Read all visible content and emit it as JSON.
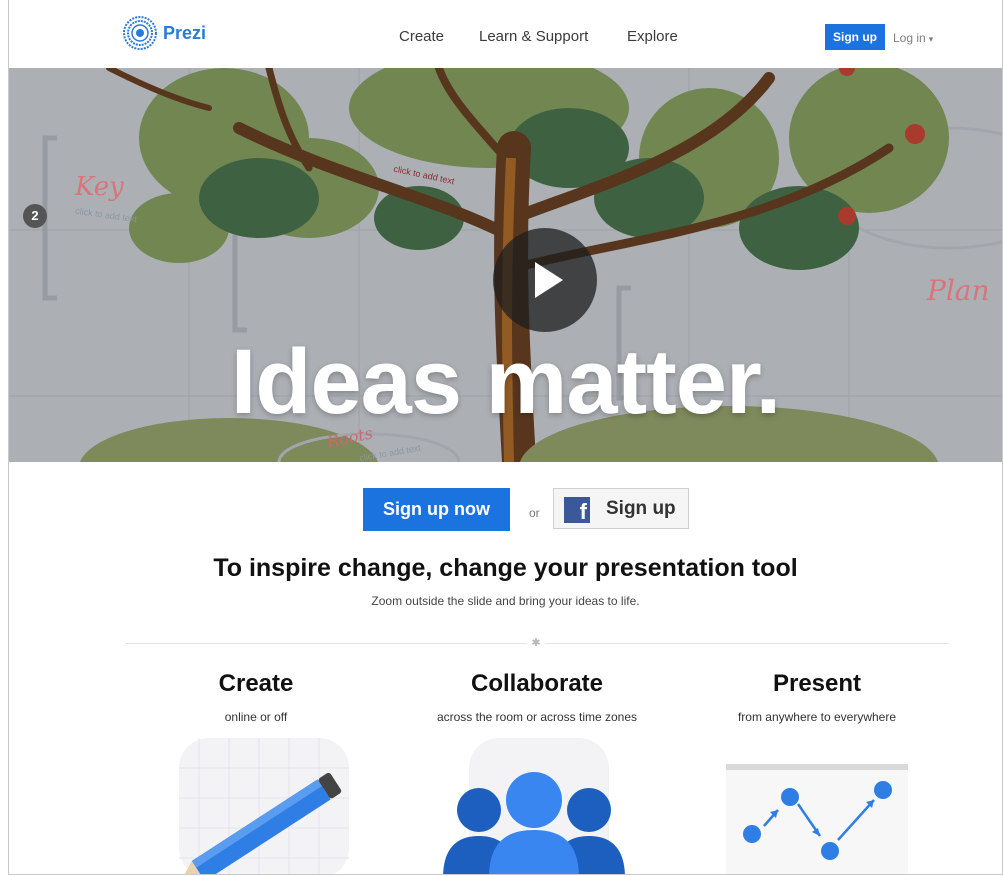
{
  "header": {
    "logo_text": "Prezi",
    "nav": [
      "Create",
      "Learn & Support",
      "Explore"
    ],
    "signup_label": "Sign up",
    "login_label": "Log in",
    "login_caret": "▾"
  },
  "hero": {
    "title": "Ideas matter.",
    "step_number": "2",
    "labels": {
      "key": "Key",
      "plan": "Plan",
      "roots": "Roots"
    },
    "hint_text": "click to add text"
  },
  "cta": {
    "primary_label": "Sign up now",
    "or_text": "or",
    "facebook_icon": "f",
    "facebook_label": "Sign up"
  },
  "tagline": {
    "title": "To inspire change, change your presentation tool",
    "subtitle": "Zoom outside the slide and bring your ideas to life."
  },
  "divider_icon": "✱",
  "features": [
    {
      "title": "Create",
      "subtitle": "online or off",
      "icon": "pencil-icon"
    },
    {
      "title": "Collaborate",
      "subtitle": "across the room or across time zones",
      "icon": "people-icon"
    },
    {
      "title": "Present",
      "subtitle": "from anywhere to everywhere",
      "icon": "line-chart-icon"
    }
  ],
  "colors": {
    "brand_blue": "#1b73e0",
    "facebook_blue": "#3b5998",
    "tree_green": "#6f8a52",
    "trunk_brown": "#6b3c1a",
    "apple_red": "#c43a2b"
  }
}
